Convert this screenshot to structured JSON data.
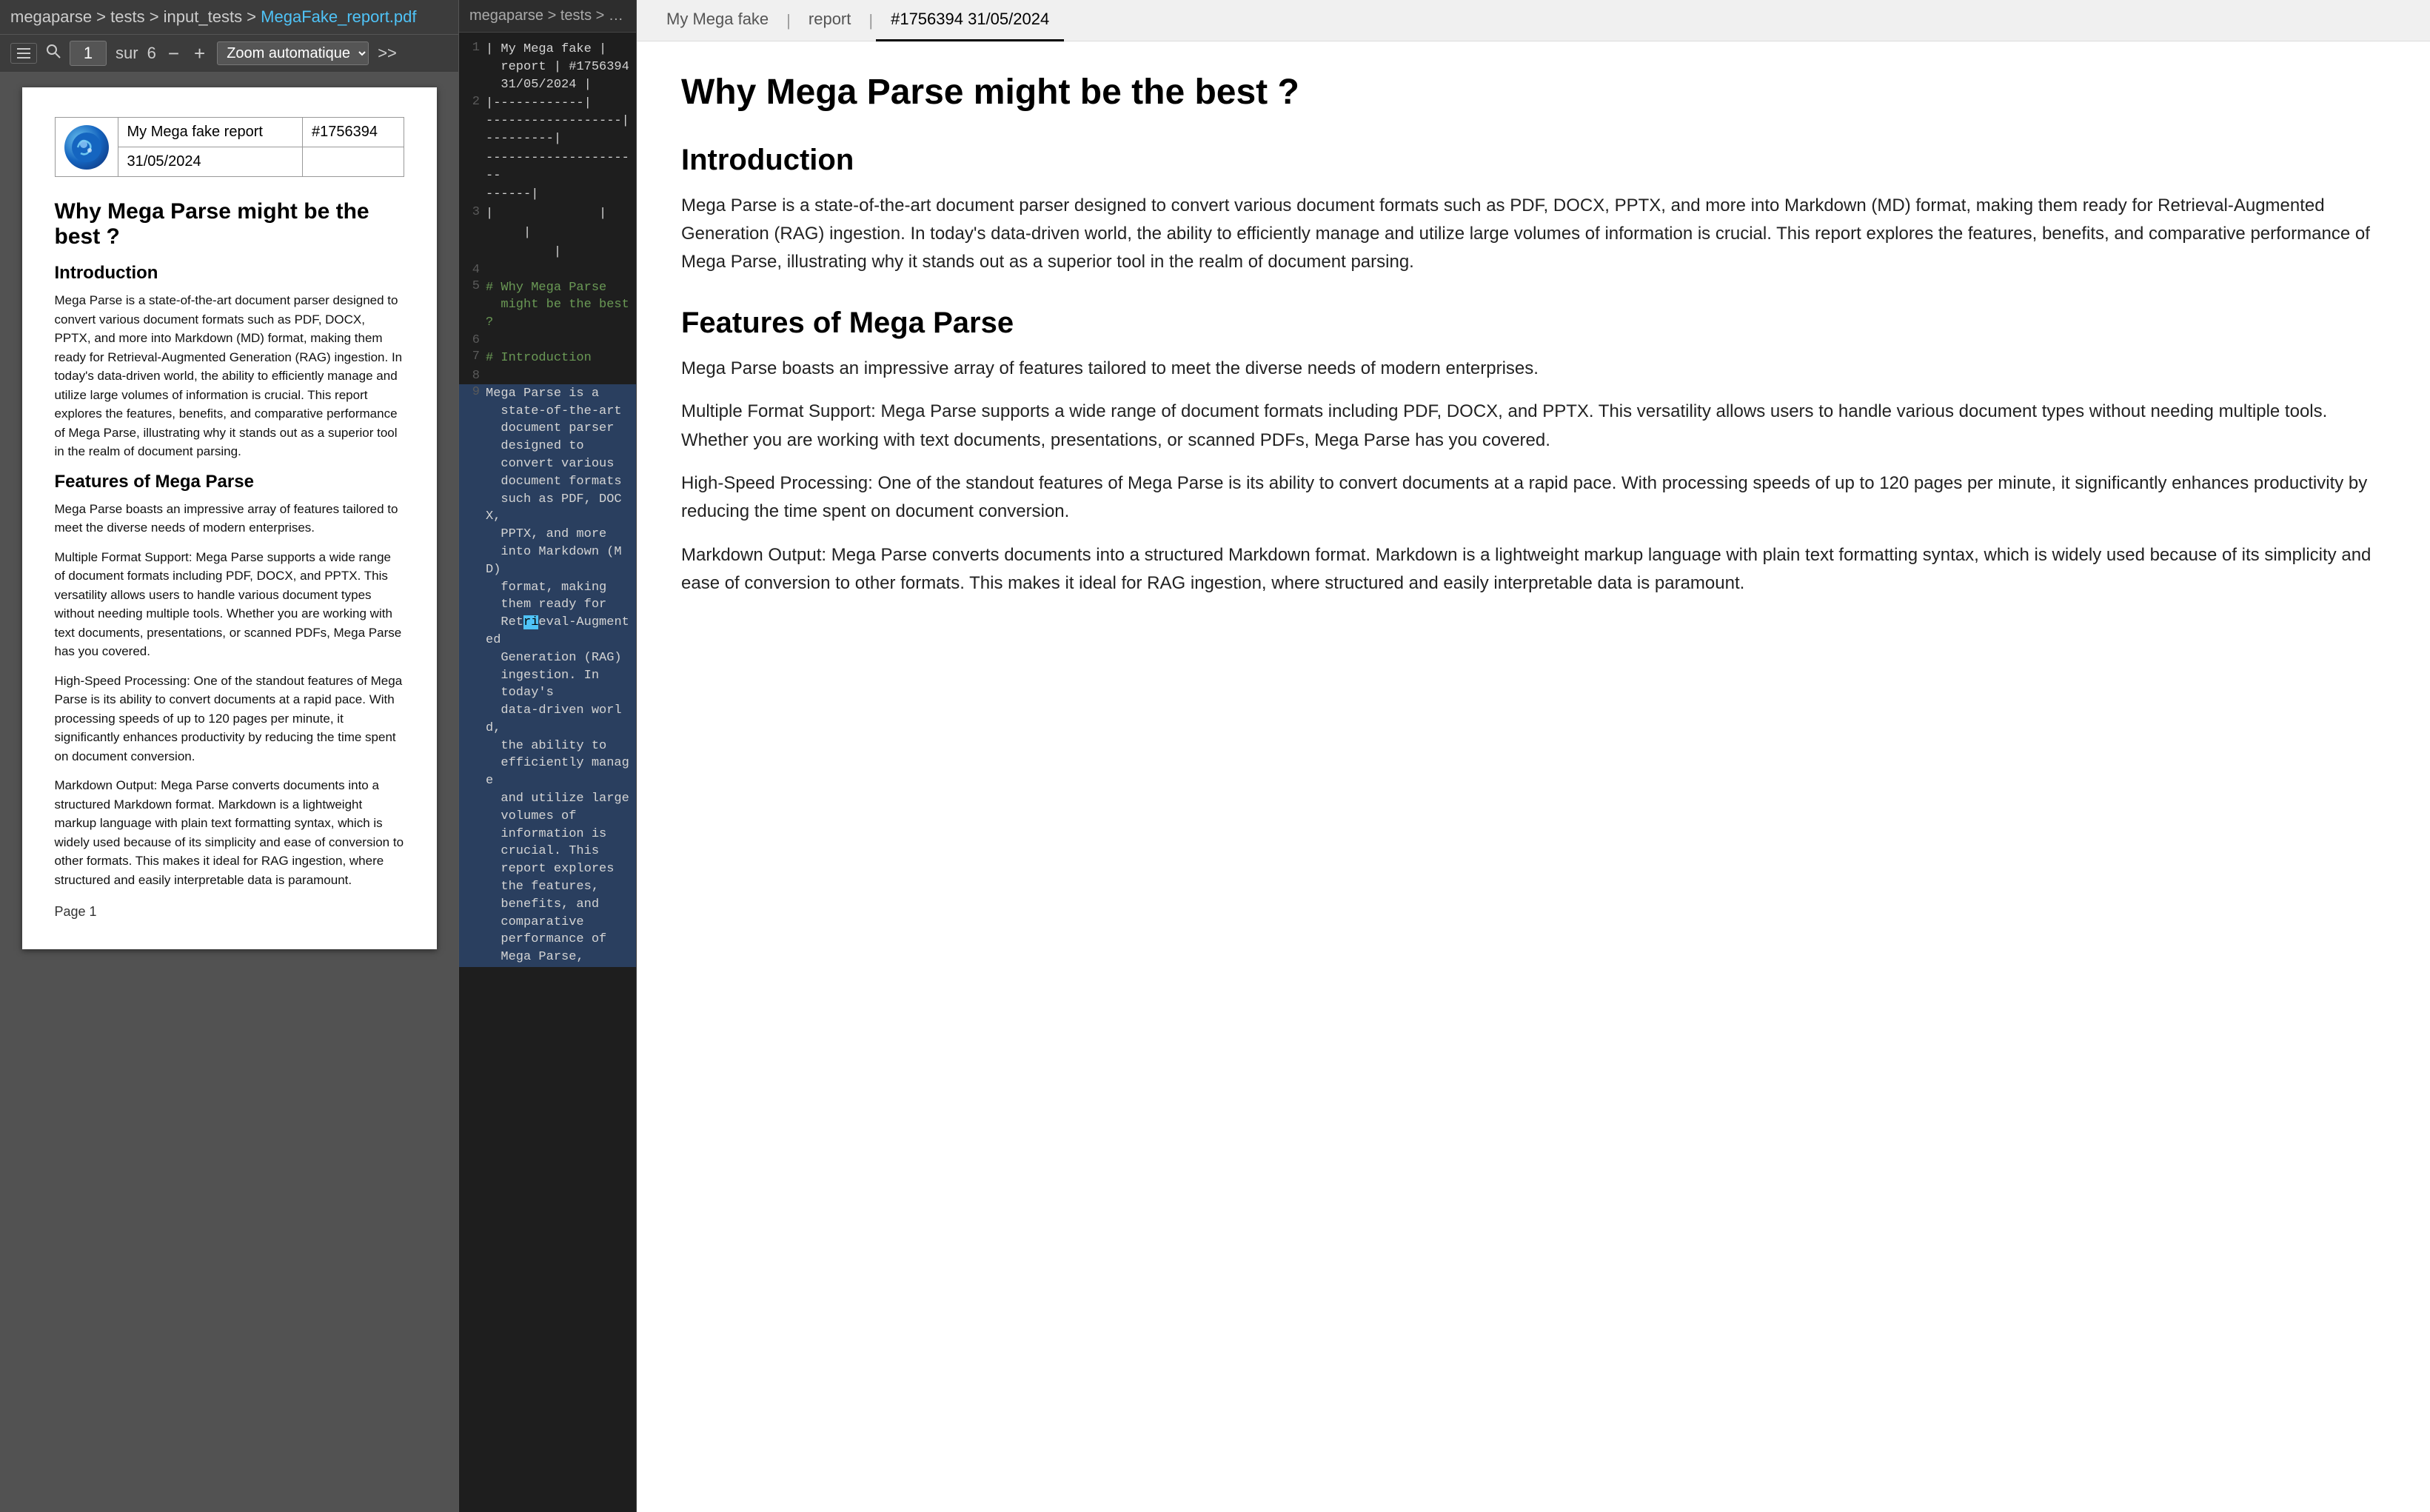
{
  "pdf_panel": {
    "breadcrumb": "megaparse > tests > input_tests > MegaFake_report.pdf",
    "breadcrumb_parts": [
      "megaparse",
      "tests",
      "input_tests",
      "MegaFake_report.pdf"
    ],
    "toolbar": {
      "page_current": "1",
      "page_total": "6",
      "page_sep": "sur",
      "zoom_label": "Zoom automatique",
      "sidebar_icon": "☰",
      "search_icon": "🔍",
      "zoom_minus": "−",
      "zoom_plus": "+",
      "more_icon": ">>"
    },
    "page": {
      "report_title": "My Mega fake report",
      "report_id": "#1756394",
      "report_date": "31/05/2024",
      "h1": "Why Mega Parse might be the best ?",
      "h2_intro": "Introduction",
      "intro_p": "Mega Parse is a state-of-the-art document parser designed to convert various document formats such as PDF, DOCX, PPTX, and more into Markdown (MD) format, making them ready for Retrieval-Augmented Generation (RAG) ingestion. In today's data-driven world, the ability to efficiently manage and utilize large volumes of information is crucial. This report explores the features, benefits, and comparative performance of Mega Parse, illustrating why it stands out as a superior tool in the realm of document parsing.",
      "h2_features": "Features of Mega Parse",
      "features_p1": "Mega Parse boasts an impressive array of features tailored to meet the diverse needs of modern enterprises.",
      "features_p2": "Multiple Format Support: Mega Parse supports a wide range of document formats including PDF, DOCX, and PPTX. This versatility allows users to handle various document types without needing multiple tools. Whether you are working with text documents, presentations, or scanned PDFs, Mega Parse has you covered.",
      "features_p3": "High-Speed Processing: One of the standout features of Mega Parse is its ability to convert documents at a rapid pace. With processing speeds of up to 120 pages per minute, it significantly enhances productivity by reducing the time spent on document conversion.",
      "features_p4": "Markdown Output: Mega Parse converts documents into a structured Markdown format. Markdown is a lightweight markup language with plain text formatting syntax, which is widely used because of its simplicity and ease of conversion to other formats. This makes it ideal for RAG ingestion, where structured and easily interpretable data is paramount.",
      "page_num": "Page 1"
    }
  },
  "code_panel": {
    "breadcrumb": "megaparse > tests > output_tests",
    "lines": [
      {
        "num": "1",
        "content": "| My Mega fake |\n  report | #1756394\n  31/05/2024 |",
        "style": ""
      },
      {
        "num": "2",
        "content": "|------------|------------------|",
        "style": ""
      },
      {
        "num": "",
        "content": "---------|",
        "style": ""
      },
      {
        "num": "",
        "content": "---------------------",
        "style": ""
      },
      {
        "num": "",
        "content": "------|",
        "style": ""
      },
      {
        "num": "3",
        "content": "|              |",
        "style": ""
      },
      {
        "num": "",
        "content": "     |",
        "style": ""
      },
      {
        "num": "",
        "content": "          |",
        "style": ""
      },
      {
        "num": "4",
        "content": "",
        "style": ""
      },
      {
        "num": "5",
        "content": "# Why Mega Parse\n  might be the best ?",
        "style": "green"
      },
      {
        "num": "6",
        "content": "",
        "style": ""
      },
      {
        "num": "7",
        "content": "# Introduction",
        "style": "green"
      },
      {
        "num": "8",
        "content": "",
        "style": ""
      },
      {
        "num": "9",
        "content": "Mega Parse is a\n  state-of-the-art\n  document parser\n  designed to\n  convert various\n  document formats\n  such as PDF, DOCX,\n  PPTX, and more\n  into Markdown (MD)\n  format, making\n  them ready for\n  Retrieval-Augmented\n  Generation (RAG)\n  ingestion. In\n  today's\n  data-driven world,\n  the ability to\n  efficiently manage\n  and utilize large\n  volumes of\n  information is\n  crucial. This\n  report explores\n  the features,\n  benefits, and\n  comparative\n  performance of\n  Mega Parse,",
        "style": ""
      }
    ]
  },
  "markdown_panel": {
    "tabs": [
      {
        "label": "My Mega fake",
        "active": false
      },
      {
        "label": "report",
        "active": false
      },
      {
        "label": "#1756394 31/05/2024",
        "active": true
      }
    ],
    "content": {
      "h1": "Why Mega Parse might be the best ?",
      "h2_intro": "Introduction",
      "intro_p": "Mega Parse is a state-of-the-art document parser designed to convert various document formats such as PDF, DOCX, PPTX, and more into Markdown (MD) format, making them ready for Retrieval-Augmented Generation (RAG) ingestion. In today's data-driven world, the ability to efficiently manage and utilize large volumes of information is crucial. This report explores the features, benefits, and comparative performance of Mega Parse, illustrating why it stands out as a superior tool in the realm of document parsing.",
      "h2_features": "Features of Mega Parse",
      "features_p1": "Mega Parse boasts an impressive array of features tailored to meet the diverse needs of modern enterprises.",
      "features_p2": "Multiple Format Support: Mega Parse supports a wide range of document formats including PDF, DOCX, and PPTX. This versatility allows users to handle various document types without needing multiple tools. Whether you are working with text documents, presentations, or scanned PDFs, Mega Parse has you covered.",
      "features_p3": "High-Speed Processing: One of the standout features of Mega Parse is its ability to convert documents at a rapid pace. With processing speeds of up to 120 pages per minute, it significantly enhances productivity by reducing the time spent on document conversion.",
      "features_p4": "Markdown Output: Mega Parse converts documents into a structured Markdown format. Markdown is a lightweight markup language with plain text formatting syntax, which is widely used because of its simplicity and ease of conversion to other formats. This makes it ideal for RAG ingestion, where structured and easily interpretable data is paramount."
    }
  }
}
